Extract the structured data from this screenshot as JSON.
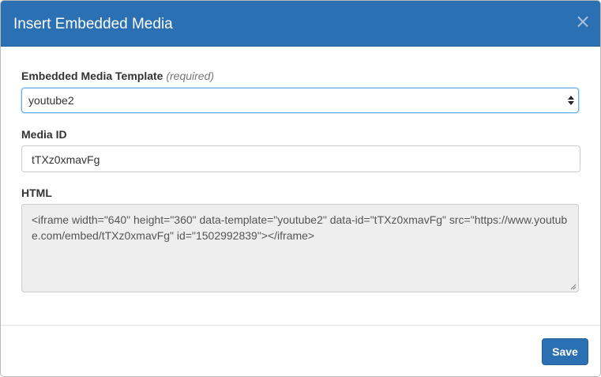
{
  "dialog": {
    "title": "Insert Embedded Media",
    "close_label": "×"
  },
  "template_field": {
    "label": "Embedded Media Template",
    "required_note": "(required)",
    "selected_value": "youtube2"
  },
  "media_id_field": {
    "label": "Media ID",
    "value": "tTXz0xmavFg"
  },
  "html_field": {
    "label": "HTML",
    "value": "<iframe width=\"640\" height=\"360\" data-template=\"youtube2\" data-id=\"tTXz0xmavFg\" src=\"https://www.youtube.com/embed/tTXz0xmavFg\" id=\"1502992839\"></iframe>"
  },
  "footer": {
    "save_label": "Save"
  },
  "colors": {
    "header_background": "#2a70b2",
    "primary_button": "#2a70b2",
    "readonly_background": "#eeeeee",
    "focus_border": "#66afe9"
  }
}
